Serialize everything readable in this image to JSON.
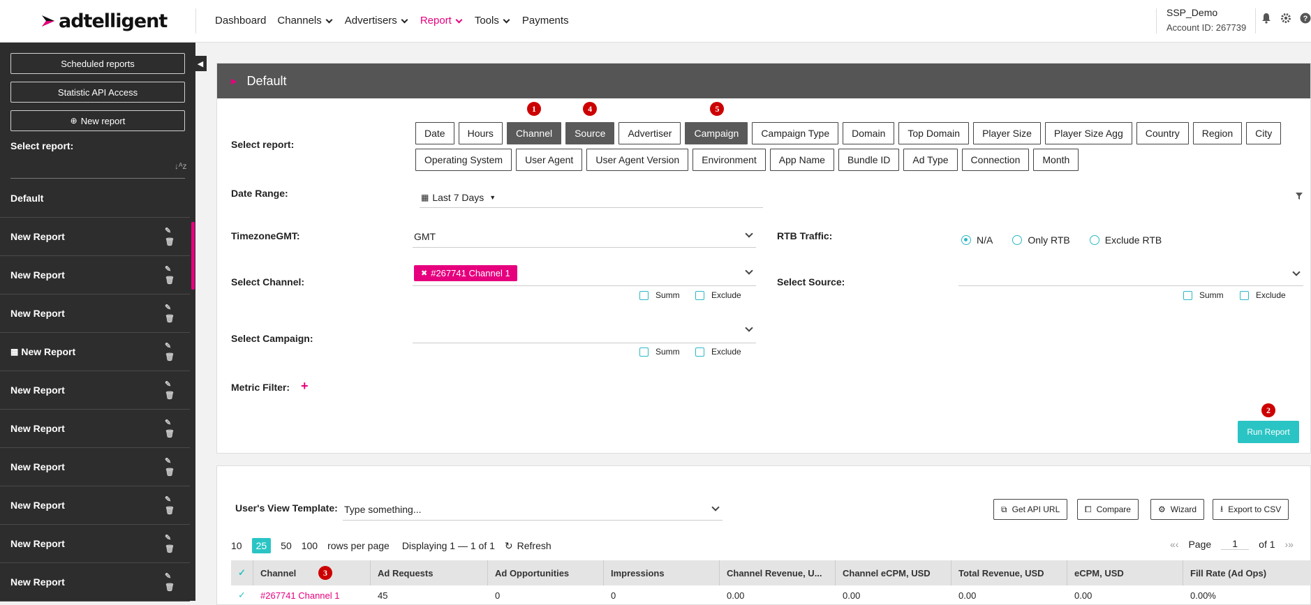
{
  "brand": {
    "name": "adtelligent",
    "accent": "#e6007e",
    "teal": "#2bc4c4"
  },
  "nav": {
    "items": [
      "Dashboard",
      "Channels",
      "Advertisers",
      "Report",
      "Tools",
      "Payments"
    ],
    "active": "Report"
  },
  "user": {
    "name": "SSP_Demo",
    "account": "Account ID: 267739"
  },
  "sidebar": {
    "scheduled": "Scheduled reports",
    "api": "Statistic API Access",
    "new_report": "New report",
    "select_label": "Select report:",
    "items": [
      "Default",
      "New Report",
      "New Report",
      "New Report",
      "New Report",
      "New Report",
      "New Report",
      "New Report",
      "New Report",
      "New Report",
      "New Report"
    ]
  },
  "panel": {
    "title": "Default",
    "select_report_label": "Select report:",
    "tags_row1": [
      "Date",
      "Hours",
      "Channel",
      "Source",
      "Advertiser",
      "Campaign",
      "Campaign Type",
      "Domain",
      "Top Domain",
      "Player Size",
      "Player Size Agg",
      "Country",
      "Region"
    ],
    "tags_row2": [
      "City",
      "Operating System",
      "User Agent",
      "User Agent Version",
      "Environment",
      "App Name",
      "Bundle ID",
      "Ad Type",
      "Connection",
      "Month"
    ],
    "date_range_label": "Date Range:",
    "date_range_value": "Last 7 Days",
    "timezone_label": "TimezoneGMT:",
    "timezone_value": "GMT",
    "rtb_label": "RTB Traffic:",
    "rtb_options": [
      "N/A",
      "Only RTB",
      "Exclude RTB"
    ],
    "channel_label": "Select Channel:",
    "channel_chip": "#267741 Channel 1",
    "source_label": "Select Source:",
    "campaign_label": "Select Campaign:",
    "summ": "Summ",
    "exclude": "Exclude",
    "metric_label": "Metric Filter:",
    "run": "Run Report"
  },
  "results": {
    "template_label": "User's View Template:",
    "template_placeholder": "Type something...",
    "buttons": [
      "Get API URL",
      "Compare",
      "Wizard",
      "Export to CSV"
    ],
    "page_sizes": [
      "10",
      "25",
      "50",
      "100"
    ],
    "rows_per_page": "rows per page",
    "displaying": "Displaying 1 — 1 of 1",
    "refresh": "Refresh",
    "page_label": "Page",
    "page_num": "1",
    "page_of": "of 1",
    "columns": [
      "Channel",
      "Ad Requests",
      "Ad Opportunities",
      "Impressions",
      "Channel Revenue, U...",
      "Channel eCPM, USD",
      "Total Revenue, USD",
      "eCPM, USD",
      "Fill Rate (Ad Ops)"
    ],
    "row": [
      "#267741 Channel 1",
      "45",
      "0",
      "0",
      "0.00",
      "0.00",
      "0.00",
      "0.00",
      "0.00%"
    ]
  },
  "badges": [
    "1",
    "4",
    "5",
    "2",
    "3"
  ]
}
